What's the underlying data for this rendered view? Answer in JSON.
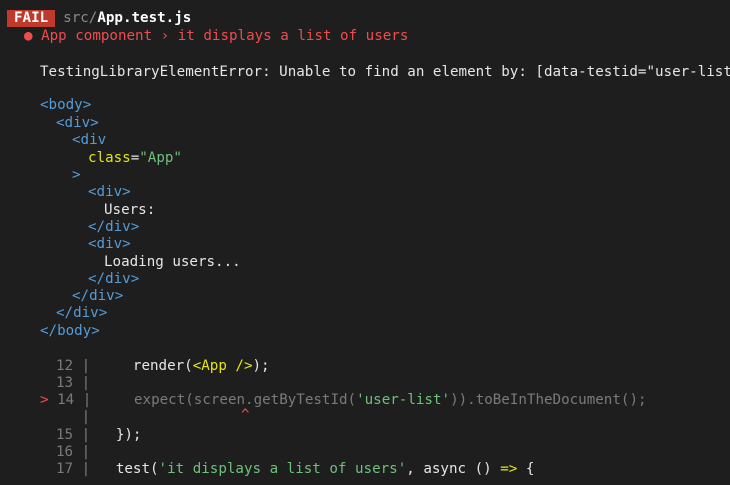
{
  "header": {
    "badge": "FAIL",
    "path_prefix": "src/",
    "file_name": "App.test.js"
  },
  "test": {
    "bullet": "●",
    "name": "App component › it displays a list of users"
  },
  "error": {
    "message": "TestingLibraryElementError: Unable to find an element by: [data-testid=\"user-list\"]"
  },
  "dom": {
    "body_open": "<body>",
    "div_open": "<div>",
    "div_open_partial": "<div",
    "attr_name": "class",
    "attr_eq": "=",
    "attr_value": "\"App\"",
    "gt": ">",
    "users_text": "Users:",
    "div_close": "</div>",
    "loading_text": "Loading users...",
    "body_close": "</body>"
  },
  "code": {
    "pipe": "|",
    "pointer": ">",
    "caret": "^",
    "l12_num": "12",
    "l12_a": "    render(",
    "l12_b": "<App />",
    "l12_c": ");",
    "l13_num": "13",
    "l14_num": "14",
    "l14_a": "    expect(screen.",
    "l14_b": "getByTestId",
    "l14_c": "(",
    "l14_d": "'user-list'",
    "l14_e": ")).",
    "l14_f": "toBeInTheDocument",
    "l14_g": "();",
    "l15_num": "15",
    "l15_text": "  });",
    "l16_num": "16",
    "l17_num": "17",
    "l17_a": "  test(",
    "l17_b": "'it displays a list of users'",
    "l17_c": ", async () ",
    "l17_d": "=>",
    "l17_e": " {"
  }
}
